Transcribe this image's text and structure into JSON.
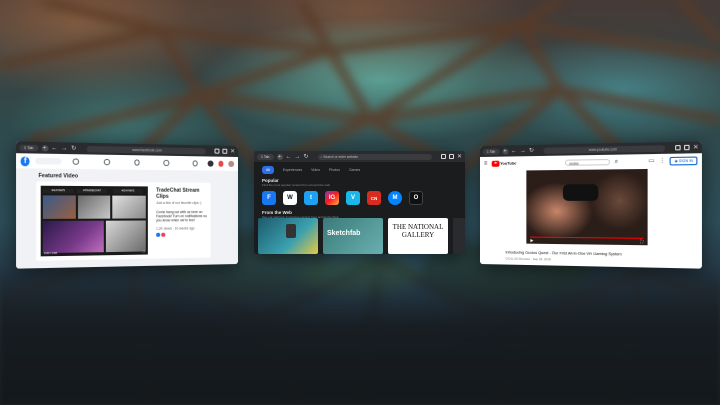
{
  "colors": {
    "facebook_blue": "#1877f2",
    "youtube_red": "#ff0000",
    "accent_blue": "#2d6fe6",
    "panel_dark": "#1b1c1e"
  },
  "icons": [
    "facebook-logo",
    "search-icon",
    "bookmark-icon",
    "refresh-icon",
    "back-icon",
    "forward-icon",
    "plus-icon",
    "close-icon",
    "signin-icon"
  ],
  "windows": [
    {
      "id": "facebook",
      "tab_label": "1 Tab",
      "url": "www.facebook.com",
      "section_title": "Featured Video",
      "video_tags": [
        "#GAYAM'S",
        "#TRADECHAT",
        "#GAYAM'S"
      ],
      "video_time": "0:00 / 0:46",
      "title": "TradeChat Stream Clips",
      "subtitle": "Just a few of our favorite clips :)",
      "body": "Come hang out with us here on Facebook! Turn on notifications so you know when we're live!",
      "meta": "1,2K views · 10 weeks ago"
    },
    {
      "id": "new-tab",
      "tab_label": "1 Tab",
      "search_placeholder": "Search or enter website",
      "tabs": [
        "All",
        "Experiences",
        "Video",
        "Photos",
        "Games"
      ],
      "popular_title": "Popular",
      "popular_sub": "Find the most popular content from around the web",
      "popular_icons": [
        "F",
        "W",
        "t",
        "IG",
        "V",
        "CN",
        "M",
        "O"
      ],
      "web_title": "From the Web",
      "web_sub": "See our partners' immersive content from across the Web",
      "tiles": [
        "",
        "Sketchfab",
        "THE NATIONAL GALLERY"
      ]
    },
    {
      "id": "youtube",
      "tab_label": "1 Tab",
      "url": "www.youtube.com",
      "brand": "YouTube",
      "search_value": "oculus",
      "signin": "SIGN IN",
      "video_title": "Introducing Oculus Quest - Our First All-in-One VR Gaming System",
      "channel": "OCULUS Reviews · Sep 26, 2018"
    }
  ]
}
